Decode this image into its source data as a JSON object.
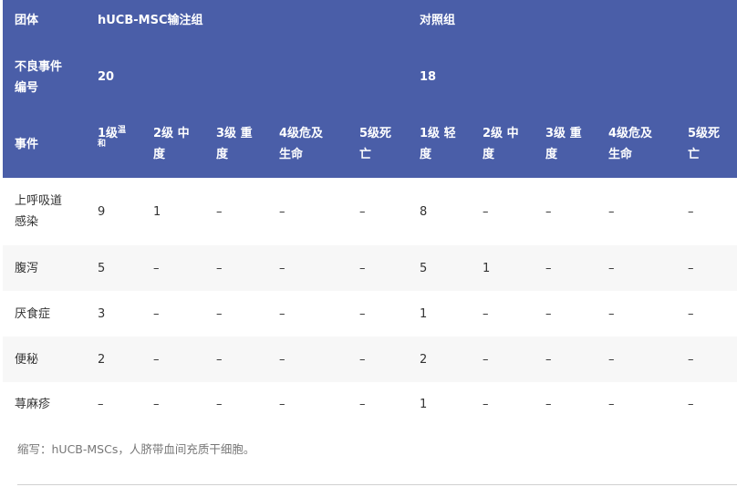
{
  "header": {
    "group_label": "团体",
    "group_treatment": "hUCB-MSC输注组",
    "group_control": "对照组",
    "adverse_label_line1": "不良事件",
    "adverse_label_line2": "编号",
    "count_treatment": "20",
    "count_control": "18",
    "event_label": "事件",
    "grades_treatment": [
      {
        "l1": "1级",
        "sup1": "温",
        "sup2": "和"
      },
      {
        "l1": "2级 中",
        "l2": "度"
      },
      {
        "l1": "3级 重",
        "l2": "度"
      },
      {
        "l1": "4级危及",
        "l2": "生命"
      },
      {
        "l1": "5级死",
        "l2": "亡"
      }
    ],
    "grades_control": [
      {
        "l1": "1级 轻",
        "l2": "度"
      },
      {
        "l1": "2级 中",
        "l2": "度"
      },
      {
        "l1": "3级 重",
        "l2": "度"
      },
      {
        "l1": "4级危及",
        "l2": "生命"
      },
      {
        "l1": "5级死",
        "l2": "亡"
      }
    ]
  },
  "rows": [
    {
      "event_l1": "上呼吸道",
      "event_l2": "感染",
      "values": [
        "9",
        "1",
        "–",
        "–",
        "–",
        "8",
        "–",
        "–",
        "–",
        "–"
      ]
    },
    {
      "event_l1": "腹泻",
      "values": [
        "5",
        "–",
        "–",
        "–",
        "–",
        "5",
        "1",
        "–",
        "–",
        "–"
      ]
    },
    {
      "event_l1": "厌食症",
      "values": [
        "3",
        "–",
        "–",
        "–",
        "–",
        "1",
        "–",
        "–",
        "–",
        "–"
      ]
    },
    {
      "event_l1": "便秘",
      "values": [
        "2",
        "–",
        "–",
        "–",
        "–",
        "2",
        "–",
        "–",
        "–",
        "–"
      ]
    },
    {
      "event_l1": "荨麻疹",
      "values": [
        "–",
        "–",
        "–",
        "–",
        "–",
        "1",
        "–",
        "–",
        "–",
        "–"
      ]
    }
  ],
  "footnote": "缩写：hUCB-MSCs，人脐带血间充质干细胞。"
}
